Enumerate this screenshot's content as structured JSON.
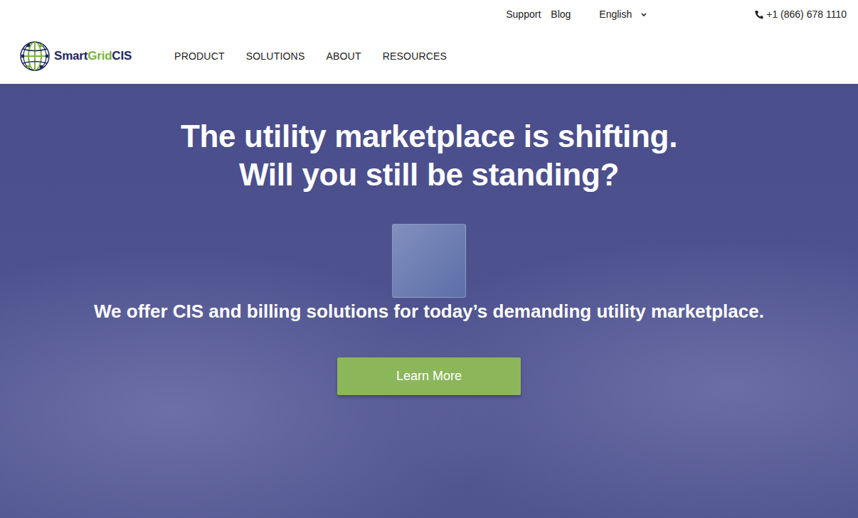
{
  "topbar": {
    "links": [
      "Support",
      "Blog"
    ],
    "language": "English",
    "phone": "+1 (866) 678 1110"
  },
  "logo": {
    "parts": [
      {
        "text": "Smart",
        "color": "#1d2660"
      },
      {
        "text": "Grid",
        "color": "#7db13d"
      },
      {
        "text": "CIS",
        "color": "#1d2660"
      }
    ]
  },
  "nav": [
    "PRODUCT",
    "SOLUTIONS",
    "ABOUT",
    "RESOURCES"
  ],
  "hero": {
    "headline": [
      "The utility marketplace is shifting.",
      "Will you still be standing?"
    ],
    "subtitle": "We offer CIS and billing solutions for today’s demanding utility marketplace.",
    "button": "Learn More"
  }
}
